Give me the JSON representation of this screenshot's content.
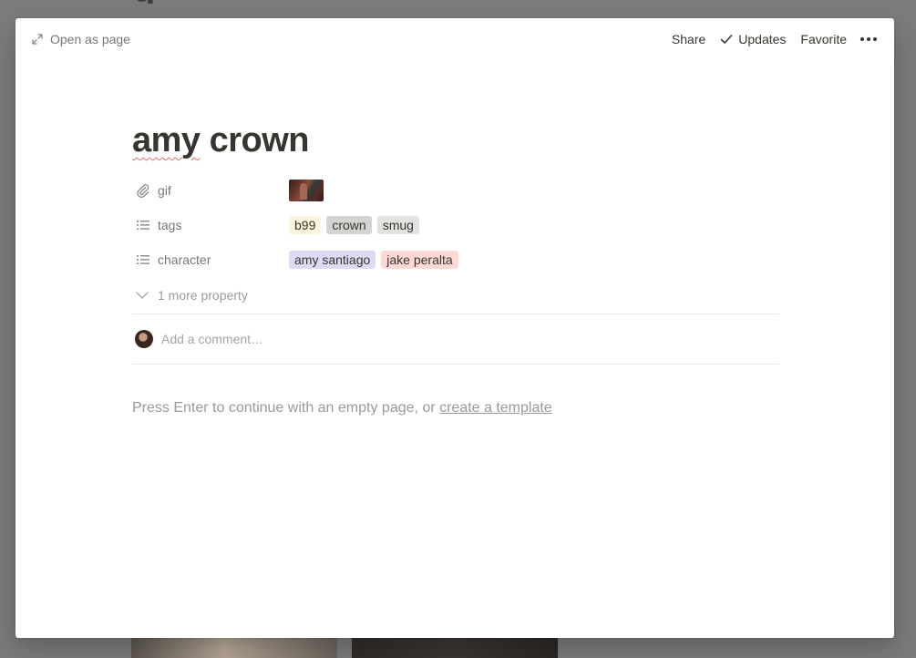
{
  "background": {
    "title_fragment": "g"
  },
  "topbar": {
    "open_as_page": "Open as page",
    "share": "Share",
    "updates": "Updates",
    "favorite": "Favorite",
    "more_icon": "more-horizontal-icon"
  },
  "page": {
    "title_misspelled": "amy",
    "title_rest": " crown",
    "properties": [
      {
        "name": "gif",
        "icon": "paperclip-icon"
      },
      {
        "name": "tags",
        "icon": "list-icon",
        "values": [
          {
            "label": "b99",
            "color": "#fbf3db"
          },
          {
            "label": "crown",
            "color": "#d3d3d1"
          },
          {
            "label": "smug",
            "color": "#e3e2e0"
          }
        ]
      },
      {
        "name": "character",
        "icon": "list-icon",
        "values": [
          {
            "label": "amy santiago",
            "color": "#e0d9f5"
          },
          {
            "label": "jake peralta",
            "color": "#fcd9d4"
          }
        ]
      }
    ],
    "more_properties": "1 more property",
    "comment_placeholder": "Add a comment…",
    "empty_hint": "Press Enter to continue with an empty page, or ",
    "create_template": "create a template"
  }
}
